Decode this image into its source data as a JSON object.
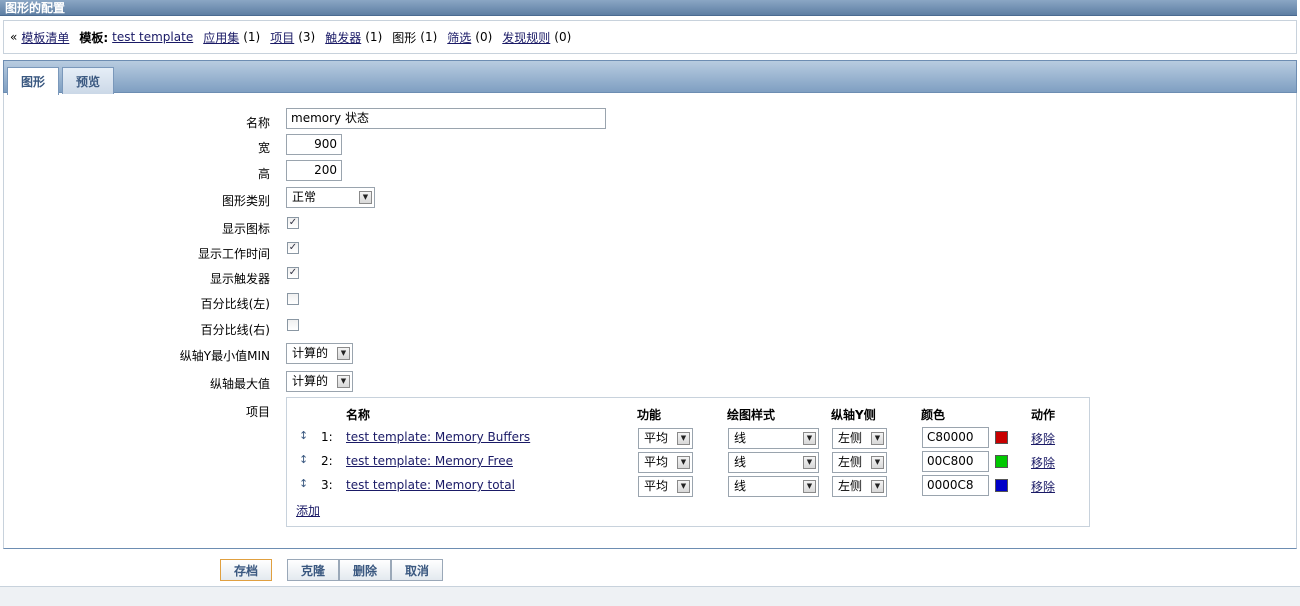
{
  "window": {
    "title": "图形的配置"
  },
  "nav": {
    "back_prefix": "«",
    "template_list": "模板清单",
    "template_label": "模板:",
    "template_name": "test template",
    "applications": "应用集",
    "applications_count": "(1)",
    "items": "项目",
    "items_count": "(3)",
    "triggers": "触发器",
    "triggers_count": "(1)",
    "graphs": "图形",
    "graphs_count": "(1)",
    "screens": "筛选",
    "screens_count": "(0)",
    "discovery": "发现规则",
    "discovery_count": "(0)"
  },
  "tabs": [
    {
      "label": "图形"
    },
    {
      "label": "预览"
    }
  ],
  "form": {
    "name_label": "名称",
    "name_value": "memory 状态",
    "width_label": "宽",
    "width_value": "900",
    "height_label": "高",
    "height_value": "200",
    "type_label": "图形类别",
    "type_value": "正常",
    "show_legend_label": "显示图标",
    "show_legend": true,
    "show_worktime_label": "显示工作时间",
    "show_worktime": true,
    "show_triggers_label": "显示触发器",
    "show_triggers": true,
    "percent_left_label": "百分比线(左)",
    "percent_left": false,
    "percent_right_label": "百分比线(右)",
    "percent_right": false,
    "ymin_label": "纵轴Y最小值MIN",
    "ymin_value": "计算的",
    "ymax_label": "纵轴最大值",
    "ymax_value": "计算的",
    "items_label": "项目"
  },
  "items_table": {
    "headers": {
      "name": "名称",
      "function": "功能",
      "draw_style": "绘图样式",
      "y_side": "纵轴Y侧",
      "color": "颜色",
      "action": "动作"
    },
    "rows": [
      {
        "num": "1:",
        "name": "test template: Memory Buffers",
        "function": "平均",
        "draw_style": "线",
        "y_side": "左侧",
        "color": "C80000",
        "color_hex": "#C80000",
        "action": "移除"
      },
      {
        "num": "2:",
        "name": "test template: Memory Free",
        "function": "平均",
        "draw_style": "线",
        "y_side": "左侧",
        "color": "00C800",
        "color_hex": "#00C800",
        "action": "移除"
      },
      {
        "num": "3:",
        "name": "test template: Memory total",
        "function": "平均",
        "draw_style": "线",
        "y_side": "左侧",
        "color": "0000C8",
        "color_hex": "#0000C8",
        "action": "移除"
      }
    ],
    "add_label": "添加"
  },
  "buttons": {
    "save": "存档",
    "clone": "克隆",
    "delete": "删除",
    "cancel": "取消"
  },
  "colors": {
    "accent": "#5d7ea3",
    "link": "#1a1a66"
  }
}
